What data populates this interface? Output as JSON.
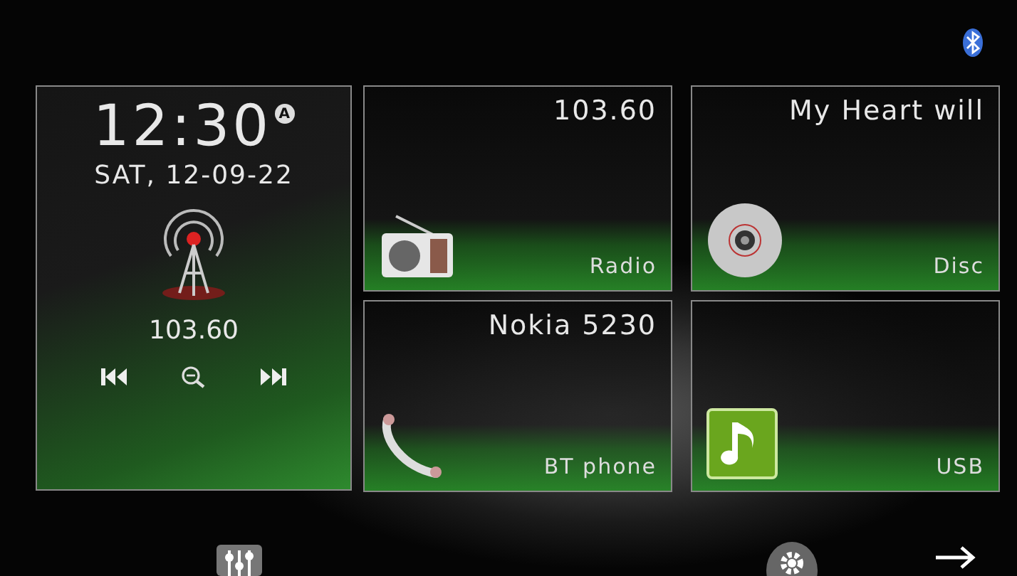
{
  "clock": {
    "time": "12:30",
    "badge": "A",
    "date": "SAT, 12-09-22",
    "frequency": "103.60"
  },
  "tiles": [
    {
      "kind": "radio",
      "title": "103.60",
      "label": "Radio"
    },
    {
      "kind": "disc",
      "title": "My Heart will",
      "label": "Disc"
    },
    {
      "kind": "phone",
      "title": "Nokia 5230",
      "label": "BT phone"
    },
    {
      "kind": "usb",
      "label": "USB"
    }
  ]
}
